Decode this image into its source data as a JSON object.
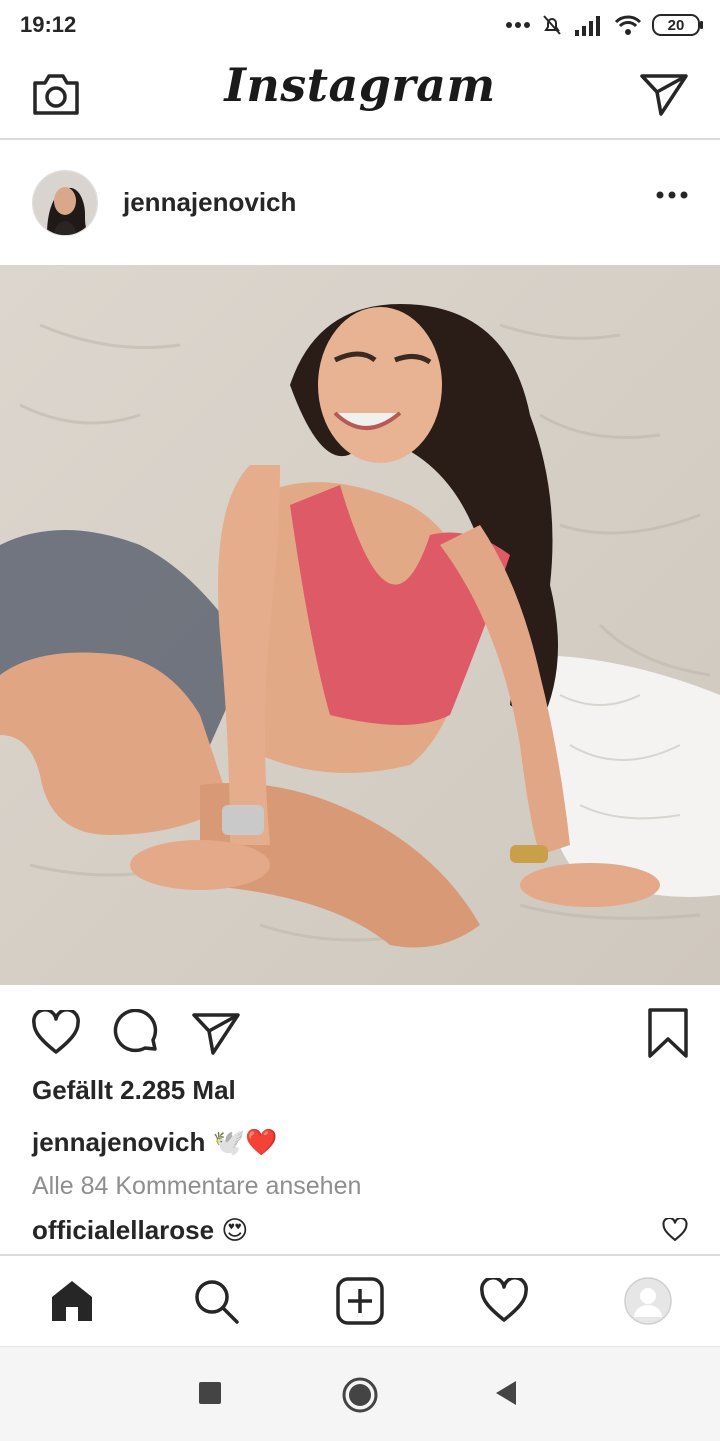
{
  "status": {
    "time": "19:12",
    "battery": "20",
    "icons": [
      "dots-icon",
      "bell-muted-icon",
      "signal-icon",
      "wifi-icon",
      "battery-icon"
    ]
  },
  "header": {
    "logo": "Instagram",
    "camera_icon": "camera-icon",
    "direct_icon": "paper-plane-icon"
  },
  "post": {
    "username": "jennajenovich",
    "likes": "Gefällt 2.285 Mal",
    "caption_user": "jennajenovich",
    "caption_text": " 🕊️❤️",
    "view_comments": "Alle 84 Kommentare ansehen",
    "comment_user": "officialellarose",
    "comment_text": " 😍"
  },
  "bottom_nav": {
    "items": [
      "home-icon",
      "search-icon",
      "add-post-icon",
      "activity-heart-icon",
      "profile-avatar"
    ]
  },
  "colors": {
    "text": "#262626",
    "muted": "#8e8e8e",
    "divider": "#dbdbdb"
  }
}
